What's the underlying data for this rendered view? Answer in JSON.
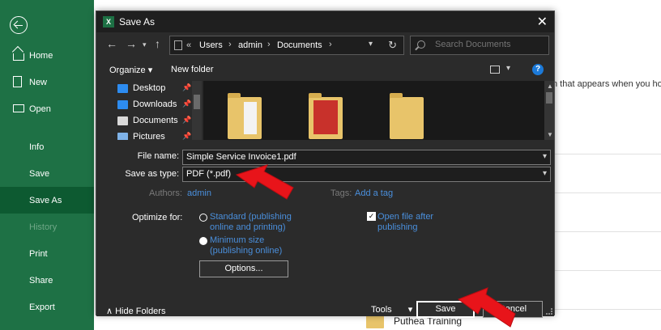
{
  "sidebar": {
    "items": [
      {
        "label": "Home"
      },
      {
        "label": "New"
      },
      {
        "label": "Open"
      },
      {
        "label": "Info"
      },
      {
        "label": "Save"
      },
      {
        "label": "Save As"
      },
      {
        "label": "History"
      },
      {
        "label": "Print"
      },
      {
        "label": "Share"
      },
      {
        "label": "Export"
      }
    ]
  },
  "background": {
    "partial_text": "n that appears when you hove",
    "folder_label": "Puthea Training"
  },
  "dialog": {
    "title": "Save As",
    "close_glyph": "✕",
    "address": {
      "lead": "«",
      "crumbs": [
        "Users",
        "admin",
        "Documents"
      ]
    },
    "search_placeholder": "Search Documents",
    "toolbar": {
      "organize": "Organize ▾",
      "new_folder": "New folder",
      "help": "?"
    },
    "nav_items": [
      {
        "label": "Desktop",
        "color": "#2d8cf0"
      },
      {
        "label": "Downloads",
        "color": "#2d8cf0"
      },
      {
        "label": "Documents",
        "color": "#d9d9d9"
      },
      {
        "label": "Pictures",
        "color": "#7fb3e8"
      }
    ],
    "file_name_label": "File name:",
    "file_name_value": "Simple Service Invoice1.pdf",
    "save_type_label": "Save as type:",
    "save_type_value": "PDF (*.pdf)",
    "authors_label": "Authors:",
    "authors_value": "admin",
    "tags_label": "Tags:",
    "tags_value": "Add a tag",
    "optimize_label": "Optimize for:",
    "opt_standard_line1": "Standard (publishing",
    "opt_standard_line2": "online and printing)",
    "opt_minimum_line1": "Minimum size",
    "opt_minimum_line2": "(publishing online)",
    "open_after_line1": "Open file after",
    "open_after_line2": "publishing",
    "options_button": "Options...",
    "hide_folders": "Hide Folders",
    "tools": "Tools",
    "save_button": "Save",
    "cancel_button": "Cancel"
  },
  "colors": {
    "excel_green": "#1e7145",
    "arrow_red": "#e8141a",
    "link_blue": "#4a8fdc"
  }
}
